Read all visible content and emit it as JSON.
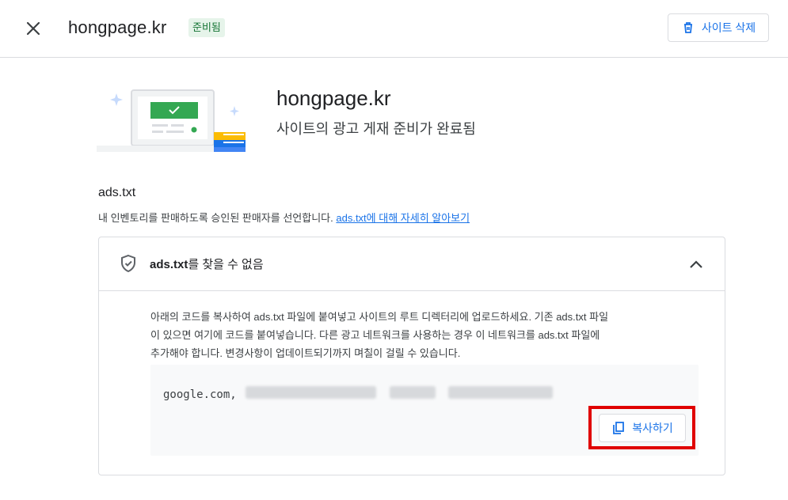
{
  "header": {
    "site_name": "hongpage.kr",
    "status_badge": "준비됨",
    "delete_label": "사이트 삭제"
  },
  "hero": {
    "title": "hongpage.kr",
    "subtitle": "사이트의 광고 게재 준비가 완료됨"
  },
  "ads_section": {
    "title": "ads.txt",
    "description": "내 인벤토리를 판매하도록 승인된 판매자를 선언합니다. ",
    "learn_more_link": "ads.txt에 대해 자세히 알아보기"
  },
  "card": {
    "status_title_bold": "ads.txt",
    "status_title_rest": "를 찾을 수 없음",
    "instructions": [
      "아래의 코드를 복사하여 ads.txt 파일에 붙여넣고 사이트의 루트 디렉터리에 업로드하세요. 기존 ads.txt 파일",
      "이 있으면 여기에 코드를 붙여넣습니다. 다른 광고 네트워크를 사용하는 경우 이 네트워크를 ads.txt 파일에",
      "추가해야 합니다. 변경사항이 업데이트되기까지 며칠이 걸릴 수 있습니다."
    ],
    "code_prefix": "google.com,",
    "copy_label": "복사하기"
  },
  "colors": {
    "accent": "#1a73e8",
    "badge_bg": "#e6f4ea",
    "badge_text": "#137333",
    "highlight": "#e00000"
  },
  "icons": [
    "close-icon",
    "trash-icon",
    "shield-check-icon",
    "chevron-up-icon",
    "copy-icon"
  ]
}
